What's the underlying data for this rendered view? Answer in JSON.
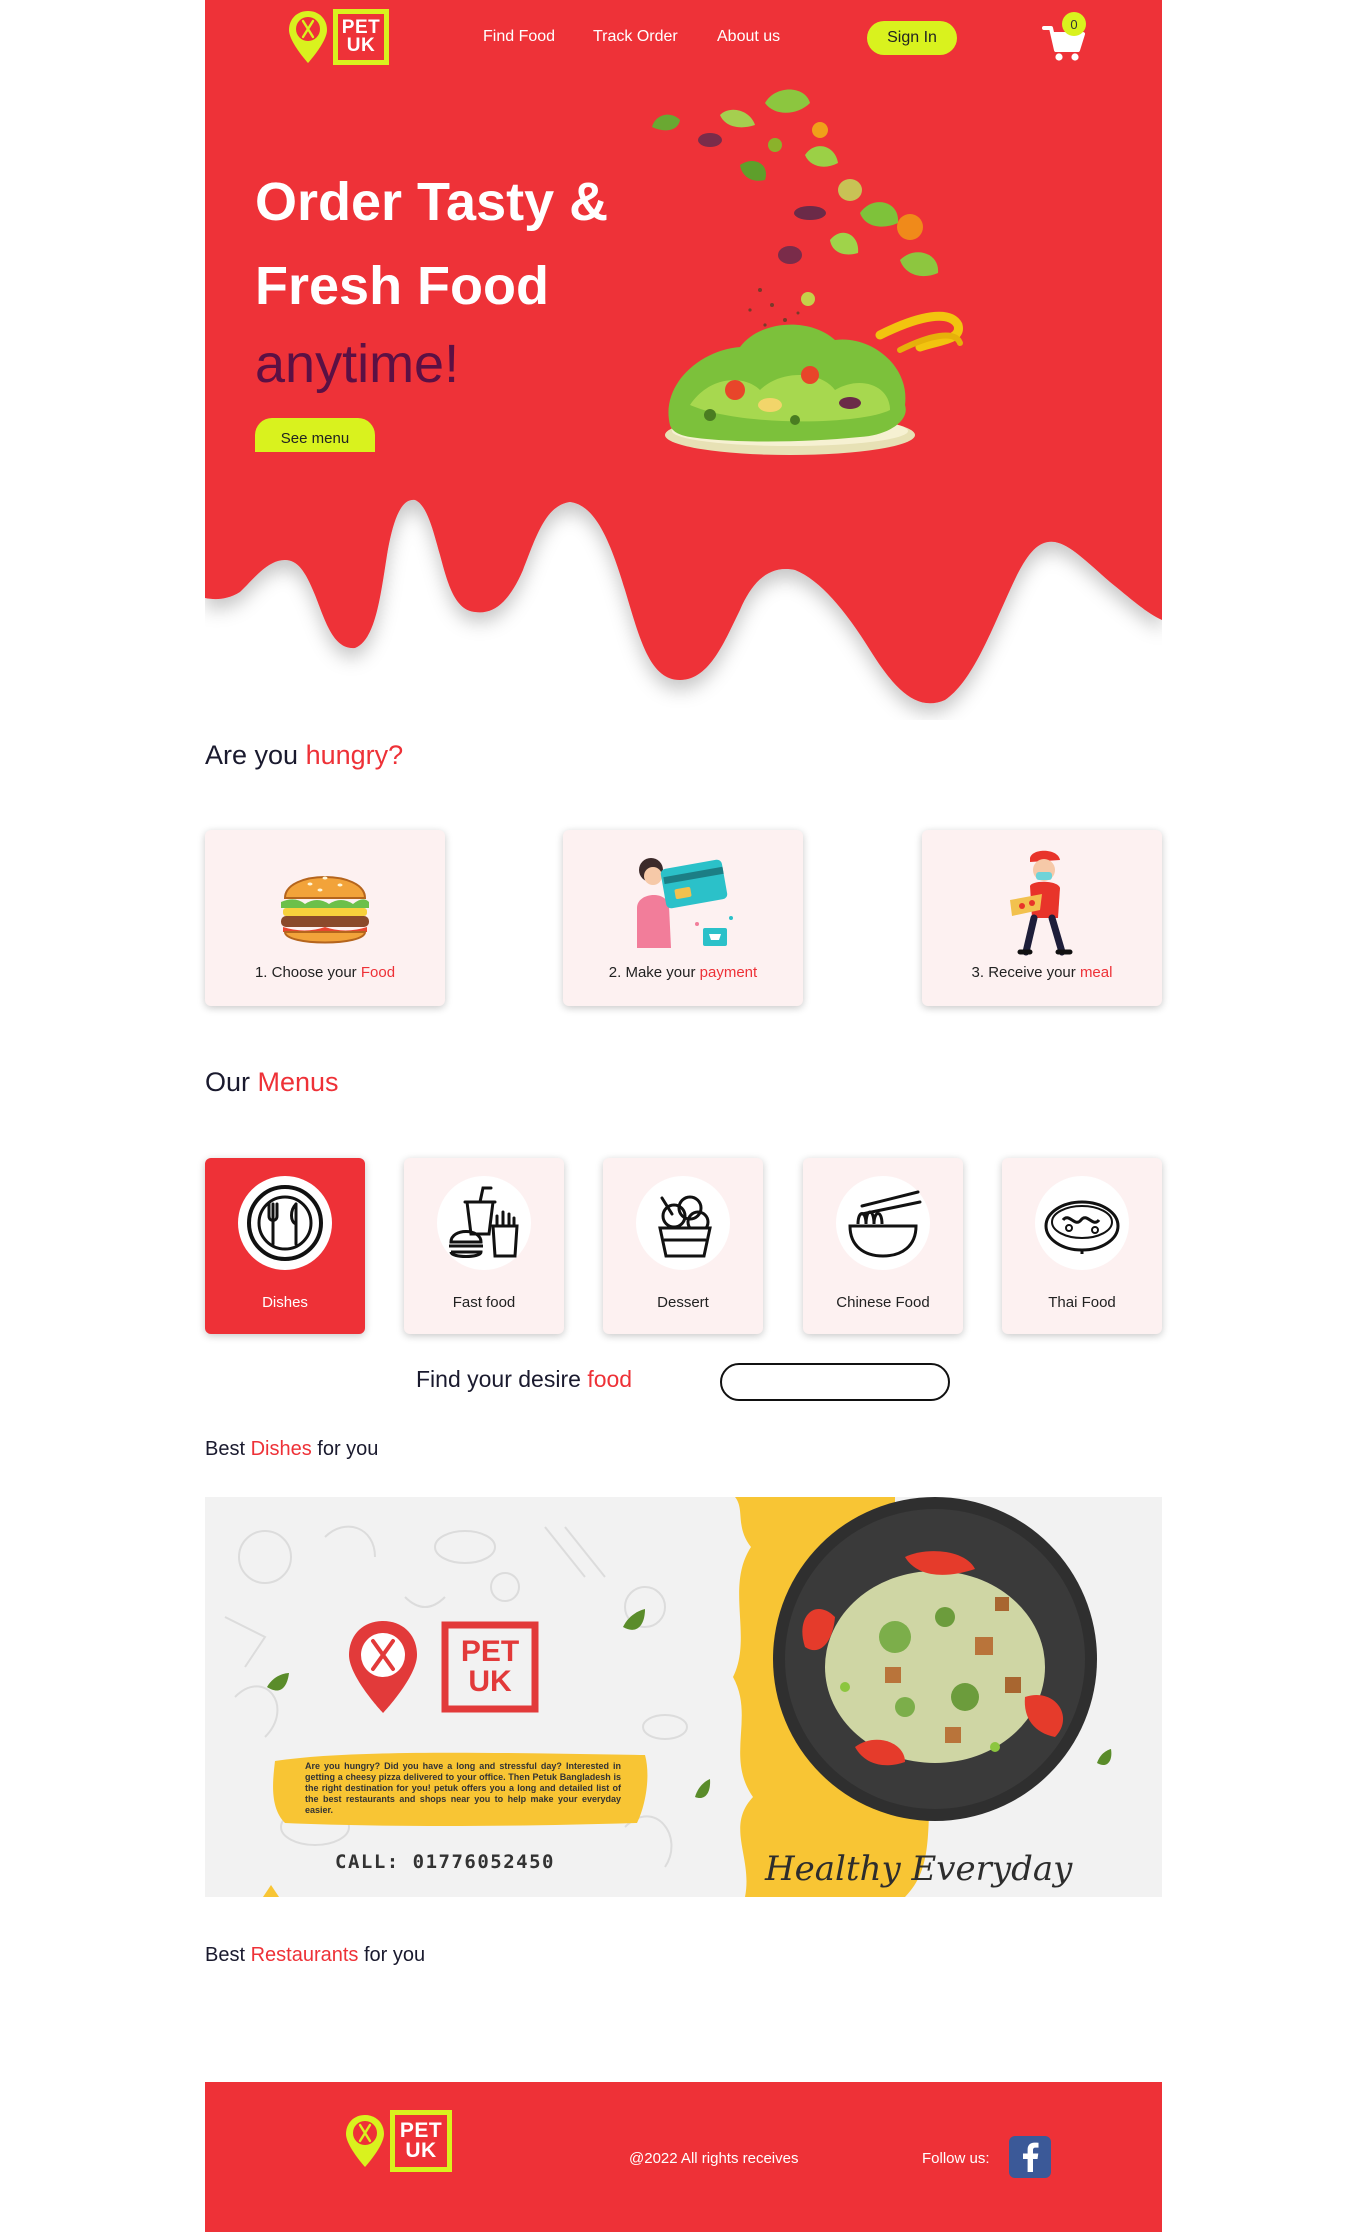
{
  "brand": {
    "logo_line1": "PET",
    "logo_line2": "UK"
  },
  "colors": {
    "primary_red": "#ee3137",
    "accent_lime": "#d9f21e",
    "dark_purple": "#5b1044"
  },
  "nav": {
    "links": [
      "Find Food",
      "Track Order",
      "About us"
    ],
    "signin_label": "Sign In",
    "cart_count": "0"
  },
  "hero": {
    "title_line1": "Order Tasty &",
    "title_line2": "Fresh Food",
    "accent": "anytime!",
    "cta_label": "See menu"
  },
  "hungry": {
    "title_plain": "Are you ",
    "title_red": "hungry?",
    "steps": [
      {
        "prefix": "1. Choose your ",
        "highlight": "Food",
        "icon": "burger-icon"
      },
      {
        "prefix": "2. Make your ",
        "highlight": "payment",
        "icon": "payment-card-icon"
      },
      {
        "prefix": "3. Receive your ",
        "highlight": "meal",
        "icon": "delivery-person-icon"
      }
    ]
  },
  "menus": {
    "title_plain": "Our ",
    "title_red": "Menus",
    "items": [
      {
        "label": "Dishes",
        "icon": "plate-cutlery-icon",
        "active": true
      },
      {
        "label": "Fast food",
        "icon": "fast-food-icon",
        "active": false
      },
      {
        "label": "Dessert",
        "icon": "ice-cream-icon",
        "active": false
      },
      {
        "label": "Chinese Food",
        "icon": "noodle-bowl-icon",
        "active": false
      },
      {
        "label": "Thai Food",
        "icon": "thai-bowl-icon",
        "active": false
      }
    ]
  },
  "search": {
    "label_plain": "Find your desire ",
    "label_red": "food",
    "placeholder": ""
  },
  "best_dishes": {
    "prefix": "Best ",
    "highlight": "Dishes",
    "suffix": " for you",
    "banner": {
      "blurb": "Are you hungry? Did you have a long and stressful day? Interested in getting a cheesy pizza delivered to your office. Then Petuk Bangladesh is the right destination for you! petuk offers you a long and detailed list of the best restaurants and shops near you to help make your everyday easier.",
      "call": "CALL:  01776052450",
      "tagline": "Healthy Everyday"
    }
  },
  "best_restaurants": {
    "prefix": "Best ",
    "highlight": "Restaurants",
    "suffix": " for you"
  },
  "footer": {
    "copyright": "@2022 All rights receives",
    "follow_label": "Follow us:",
    "social_icon": "facebook-icon"
  }
}
